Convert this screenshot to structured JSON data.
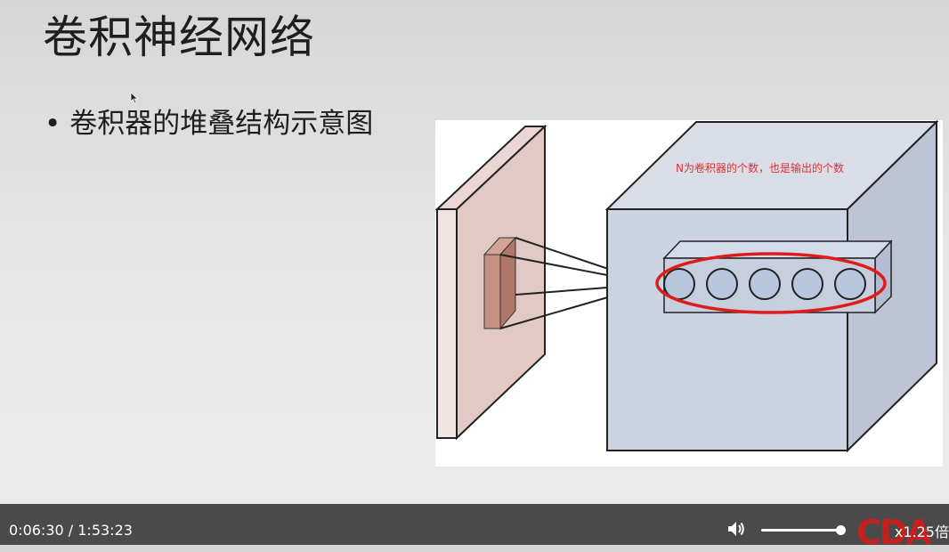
{
  "slide": {
    "title": "卷积神经网络",
    "bullet": "卷积器的堆叠结构示意图",
    "bullet_marker": "•",
    "figure": {
      "annotation": "N为卷积器的个数，也是输出的个数",
      "annotation_color": "#e53030",
      "neuron_count": 5,
      "highlight_color": "#e01b1b"
    }
  },
  "player": {
    "time": "0:06:30 / 1:53:23",
    "volume_icon": "volume-icon",
    "volume_level": 1.0,
    "logo": "CDA",
    "speed": "x1.25倍"
  }
}
